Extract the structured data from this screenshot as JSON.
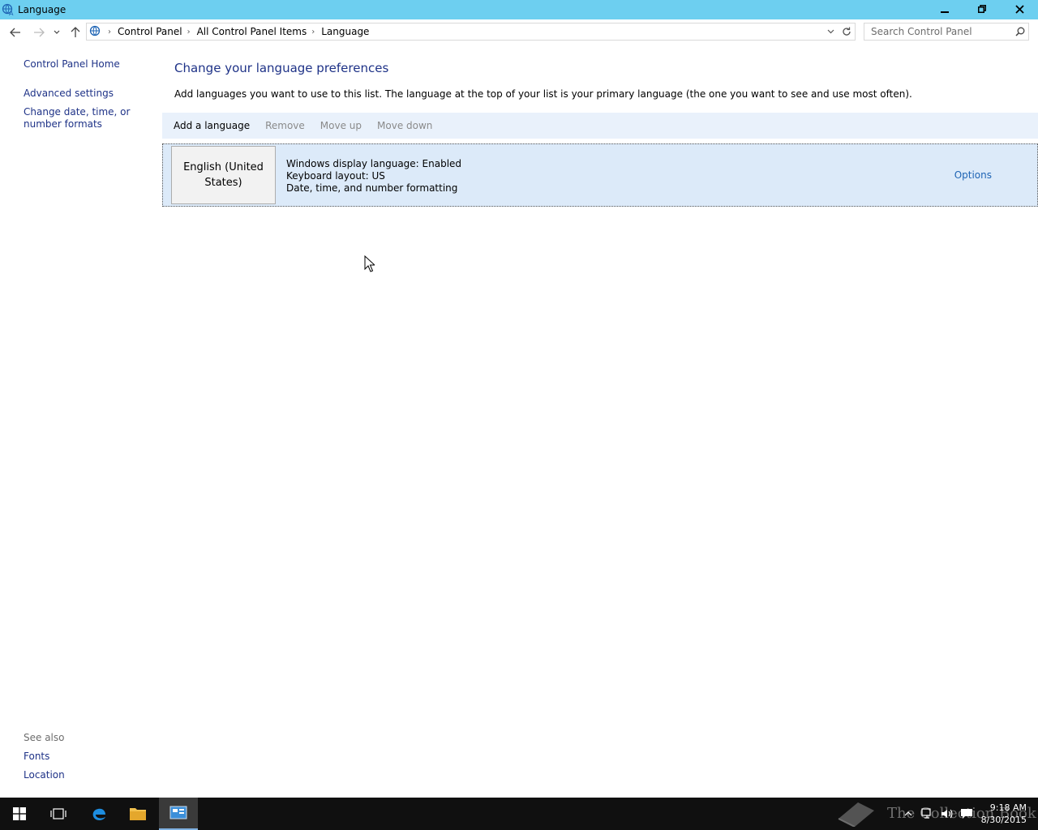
{
  "window": {
    "title": "Language",
    "controls": {
      "minimize": "minimize",
      "restore": "restore",
      "close": "close"
    }
  },
  "address": {
    "breadcrumbs": [
      "Control Panel",
      "All Control Panel Items",
      "Language"
    ],
    "search_placeholder": "Search Control Panel"
  },
  "sidebar": {
    "items": [
      {
        "label": "Control Panel Home"
      },
      {
        "label": "Advanced settings"
      },
      {
        "label": "Change date, time, or number formats"
      }
    ],
    "see_also_label": "See also",
    "see_also": [
      {
        "label": "Fonts"
      },
      {
        "label": "Location"
      }
    ]
  },
  "main": {
    "heading": "Change your language preferences",
    "description": "Add languages you want to use to this list. The language at the top of your list is your primary language (the one you want to see and use most often).",
    "toolbar": {
      "add": "Add a language",
      "remove": "Remove",
      "move_up": "Move up",
      "move_down": "Move down"
    },
    "languages": [
      {
        "name": "English (United States)",
        "details": [
          "Windows display language: Enabled",
          "Keyboard layout: US",
          "Date, time, and number formatting"
        ],
        "options_label": "Options"
      }
    ]
  },
  "taskbar": {
    "watermark": "The Collection Book",
    "time": "9:18 AM",
    "date": "8/30/2015"
  },
  "colors": {
    "titlebar": "#6dcff0",
    "link": "#1e3287",
    "toolbar_bg": "#e9f1fb",
    "selected_row": "#dceaf9",
    "taskbar": "#101010"
  }
}
